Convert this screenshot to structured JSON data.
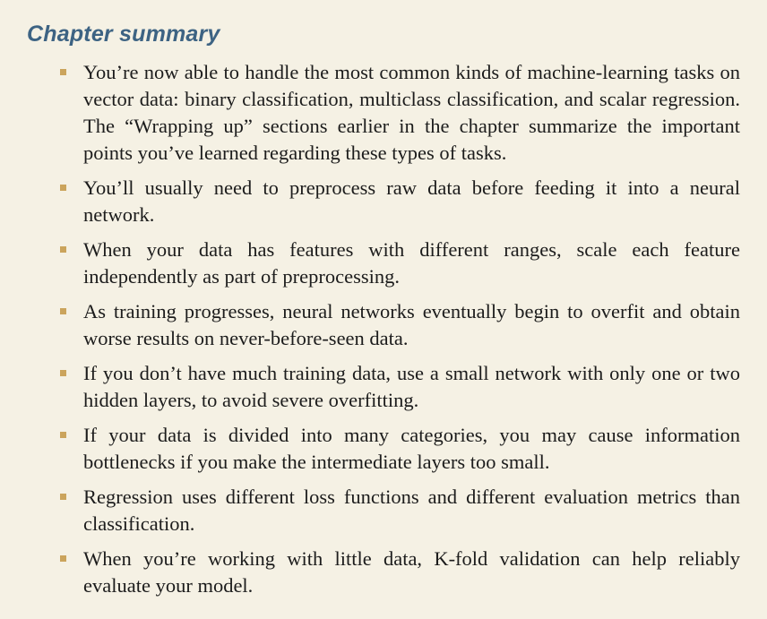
{
  "summary": {
    "title": "Chapter summary",
    "items": [
      "You’re now able to handle the most common kinds of machine-learning tasks on vector data: binary classification, multiclass classification, and scalar regression. The “Wrapping up” sections earlier in the chapter summarize the important points you’ve learned regarding these types of tasks.",
      "You’ll usually need to preprocess raw data before feeding it into a neural network.",
      "When your data has features with different ranges, scale each feature independently as part of preprocessing.",
      "As training progresses, neural networks eventually begin to overfit and obtain worse results on never-before-seen data.",
      "If you don’t have much training data, use a small network with only one or two hidden layers, to avoid severe overfitting.",
      "If your data is divided into many categories, you may cause information bottlenecks if you make the intermediate layers too small.",
      "Regression uses different loss functions and different evaluation metrics than classification.",
      "When you’re working with little data, K-fold validation can help reliably evaluate your model."
    ]
  },
  "colors": {
    "background": "#f5f1e4",
    "title": "#3d6383",
    "bullet": "#cba45c",
    "text": "#1c1c1c"
  }
}
